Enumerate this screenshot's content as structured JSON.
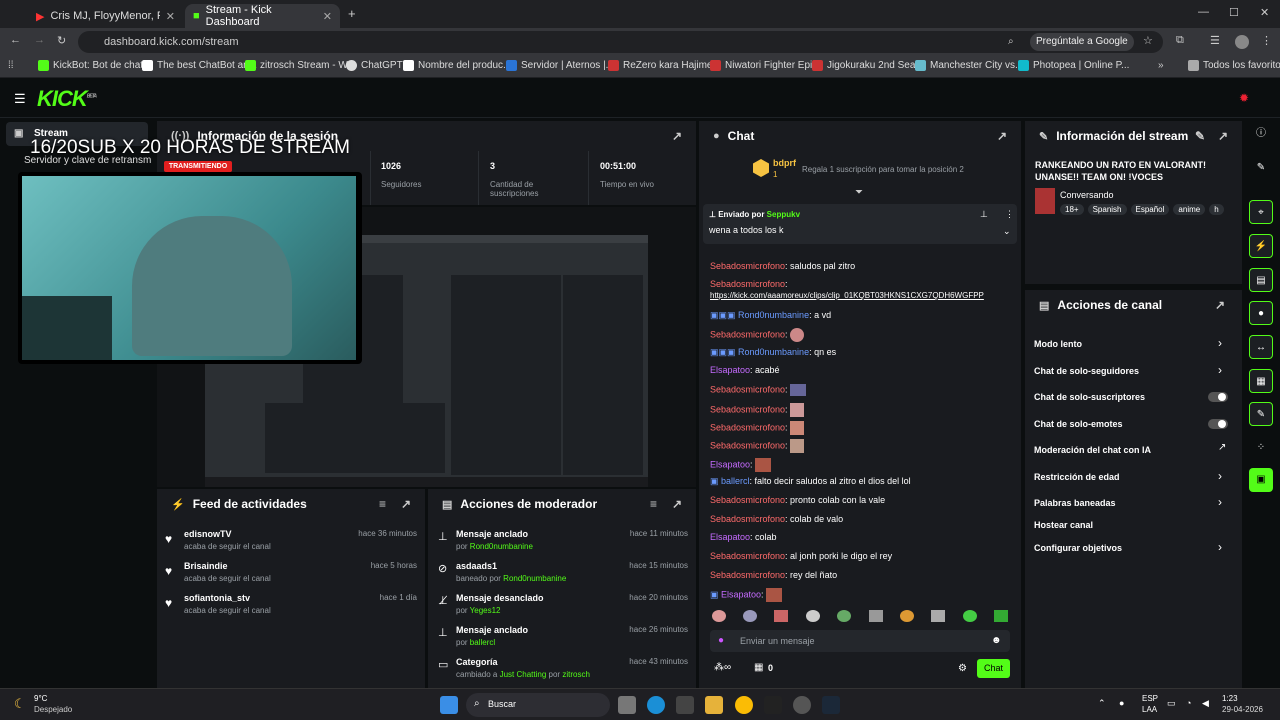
{
  "browser": {
    "tabs": [
      {
        "label": "Cris MJ, FloyyMenor, Panda Bl..."
      },
      {
        "label": "Stream - Kick Dashboard"
      }
    ],
    "url": "dashboard.kick.com/stream",
    "google_btn": "Pregúntale a Google",
    "bookmarks": [
      "KickBot: Bot de chat...",
      "The best ChatBot an...",
      "zitrosch Stream - W...",
      "ChatGPT",
      "Nombre del produc...",
      "Servidor | Aternos |...",
      "ReZero kara Hajime...",
      "Niwatori Fighter Epi...",
      "Jigokuraku 2nd Sea...",
      "Manchester City vs...",
      "Photopea | Online P..."
    ],
    "all_bookmarks": "Todos los favoritos"
  },
  "kick": {
    "logo": "KICK",
    "logo_tag": "BETA"
  },
  "sidebar": {
    "stream_label": "Stream"
  },
  "overlay": {
    "title": "16/20SUB X  20 HORAS DE STREAM",
    "server_text": "Servidor y clave de retransm"
  },
  "session": {
    "title": "Información de la sesión",
    "badge": "TRANSMITIENDO",
    "stats": [
      {
        "value": "1026",
        "label": "Seguidores"
      },
      {
        "value": "3",
        "label": "Cantidad de suscripciones"
      },
      {
        "value": "00:51:00",
        "label": "Tiempo en vivo"
      }
    ]
  },
  "chat": {
    "title": "Chat",
    "gift_user": "bdprf",
    "gift_count": "1",
    "gift_text": "Regala 1 suscripción para tomar la posición 2",
    "pinned_by": "Enviado por",
    "pinned_user": "Seppukv",
    "pinned_text": "wena a todos los k",
    "messages": [
      {
        "user": "Sebadosmicrofono",
        "text": ": saludos pal zitro"
      },
      {
        "user": "Sebadosmicrofono",
        "text": ":"
      },
      {
        "user": "",
        "text": "https://kick.com/aaamoreux/clips/clip_01KQBT03HKNS1CXG7QDH6WGFPP"
      },
      {
        "user": "Rond0numbanine",
        "text": ": a vd"
      },
      {
        "user": "Sebadosmicrofono",
        "text": ":"
      },
      {
        "user": "Rond0numbanine",
        "text": ": qn es"
      },
      {
        "user": "Elsapatoo",
        "text": ": acabé"
      },
      {
        "user": "Sebadosmicrofono",
        "text": ":"
      },
      {
        "user": "Sebadosmicrofono",
        "text": ":"
      },
      {
        "user": "Sebadosmicrofono",
        "text": ":"
      },
      {
        "user": "Sebadosmicrofono",
        "text": ":"
      },
      {
        "user": "Elsapatoo",
        "text": ":"
      },
      {
        "user": "ballercl",
        "text": ": falto decir saludos al zitro el dios del lol"
      },
      {
        "user": "Sebadosmicrofono",
        "text": ": pronto colab con la vale"
      },
      {
        "user": "Sebadosmicrofono",
        "text": ": colab de valo"
      },
      {
        "user": "Elsapatoo",
        "text": ": colab"
      },
      {
        "user": "Sebadosmicrofono",
        "text": ": al jonh porki le digo el rey"
      },
      {
        "user": "Sebadosmicrofono",
        "text": ": rey del ñato"
      },
      {
        "user": "Elsapatoo",
        "text": ":"
      }
    ],
    "input_placeholder": "Enviar un mensaje",
    "count": "0",
    "send_label": "Chat"
  },
  "stream_info": {
    "title": "Información del stream",
    "stream_title": "RANKEANDO UN RATO EN VALORANT! UNANSE!! TEAM ON! !VOCES",
    "category": "Conversando",
    "tags": [
      "18+",
      "Spanish",
      "Español",
      "anime",
      "h"
    ]
  },
  "channel_actions": {
    "title": "Acciones de canal",
    "items": [
      "Modo lento",
      "Chat de solo-seguidores",
      "Chat de solo-suscriptores",
      "Chat de solo-emotes",
      "Moderación del chat con IA",
      "Restricción de edad",
      "Palabras baneadas",
      "Hostear canal",
      "Configurar objetivos"
    ]
  },
  "feed": {
    "title": "Feed de actividades",
    "items": [
      {
        "user": "edisnowTV",
        "action": "acaba de seguir el canal",
        "time": "hace 36 minutos"
      },
      {
        "user": "Brisaindie",
        "action": "acaba de seguir el canal",
        "time": "hace 5 horas"
      },
      {
        "user": "sofiantonia_stv",
        "action": "acaba de seguir el canal",
        "time": "hace 1 día"
      }
    ]
  },
  "mod": {
    "title": "Acciones de moderador",
    "items": [
      {
        "title": "Mensaje anclado",
        "prefix": "por",
        "user": "Rond0numbanine",
        "time": "hace 11 minutos"
      },
      {
        "title": "asdaads1",
        "prefix": "baneado por",
        "user": "Rond0numbanine",
        "time": "hace 15 minutos"
      },
      {
        "title": "Mensaje desanclado",
        "prefix": "por",
        "user": "Yeges12",
        "time": "hace 20 minutos"
      },
      {
        "title": "Mensaje anclado",
        "prefix": "por",
        "user": "ballercl",
        "time": "hace 26 minutos"
      },
      {
        "title": "Categoría",
        "prefix": "cambiado a",
        "user": "Just Chatting",
        "suffix": "por",
        "user2": "zitrosch",
        "time": "hace 43 minutos"
      }
    ]
  },
  "taskbar": {
    "temp": "9°C",
    "weather": "Despejado",
    "search": "Buscar",
    "lang": "ESP",
    "lang2": "LAA",
    "time": "1:23",
    "date": "29-04-2026"
  }
}
